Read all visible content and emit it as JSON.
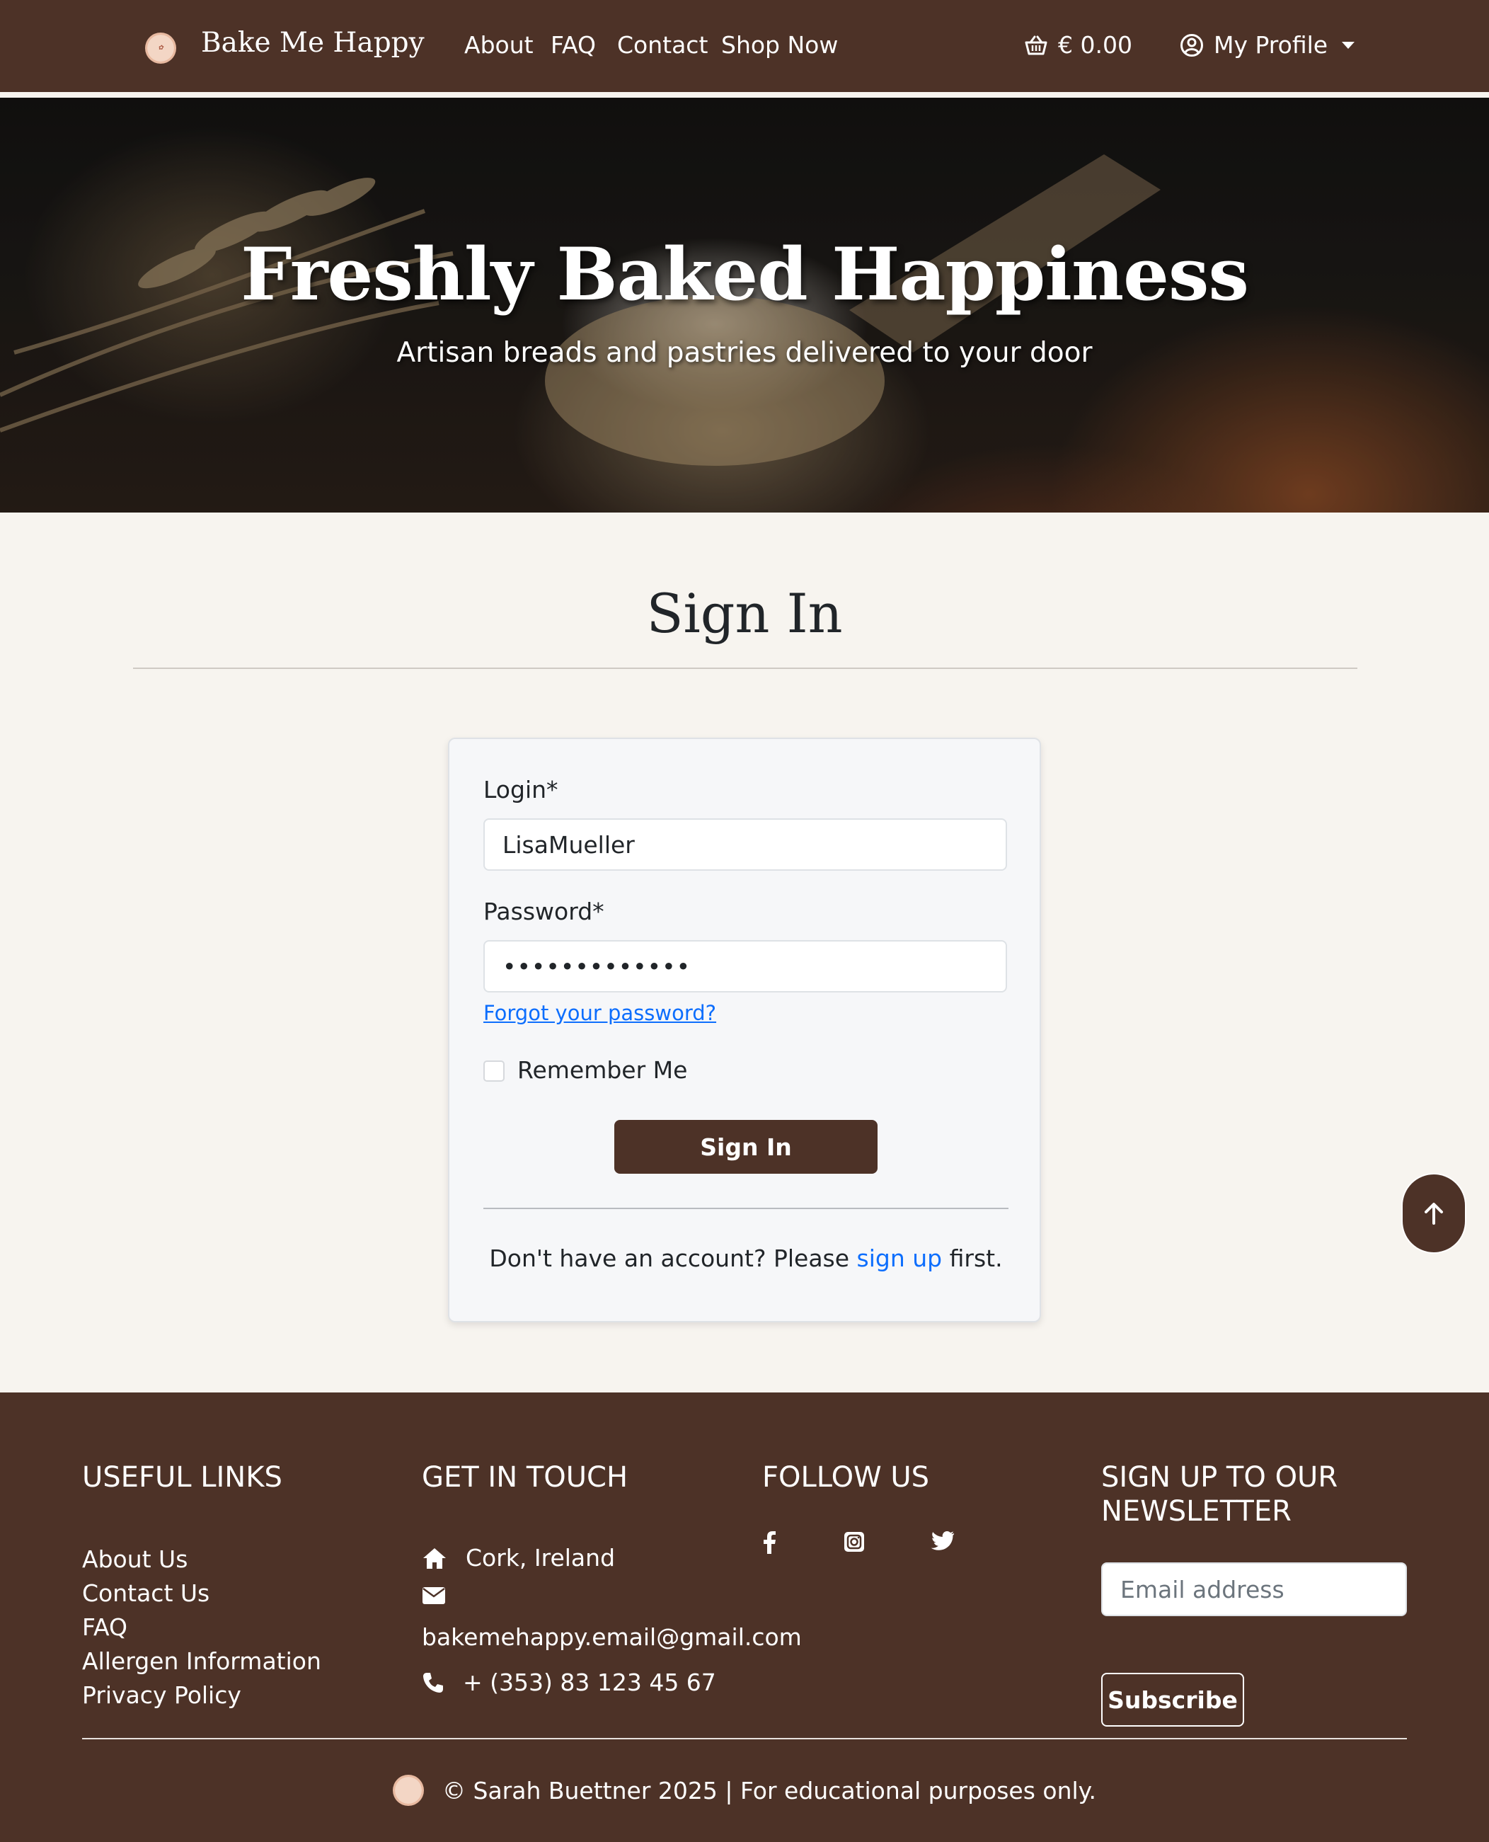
{
  "nav": {
    "brand": "Bake Me Happy",
    "links": [
      "About",
      "FAQ",
      "Contact",
      "Shop Now"
    ],
    "cart_total": "€ 0.00",
    "profile_label": "My Profile"
  },
  "hero": {
    "title": "Freshly Baked Happiness",
    "subtitle": "Artisan breads and pastries delivered to your door"
  },
  "signin": {
    "page_title": "Sign In",
    "login_label": "Login*",
    "login_value": "LisaMueller",
    "password_label": "Password*",
    "password_value": "•••••••••••••",
    "forgot_link": "Forgot your password?",
    "remember_label": "Remember Me",
    "button_label": "Sign In",
    "signup_prefix": "Don't have an account? Please",
    "signup_link": "sign up",
    "signup_suffix": "first."
  },
  "footer": {
    "useful_links_heading": "USEFUL LINKS",
    "useful_links": [
      "About Us",
      "Contact Us",
      "FAQ",
      "Allergen Information",
      "Privacy Policy"
    ],
    "get_in_touch_heading": "GET IN TOUCH",
    "location": "Cork, Ireland",
    "email": "bakemehappy.email@gmail.com",
    "phone": "+ (353) 83 123 45 67",
    "follow_heading": "FOLLOW US",
    "social_icons": [
      "facebook-icon",
      "instagram-icon",
      "twitter-icon"
    ],
    "newsletter_heading": "SIGN UP TO OUR NEWSLETTER",
    "newsletter_placeholder": "Email address",
    "subscribe_label": "Subscribe",
    "copyright": "© Sarah Buettner 2025 | For educational purposes only."
  },
  "colors": {
    "brand_brown": "#4d3227",
    "page_background": "#f7f4ef",
    "link_blue": "#0d6efd"
  }
}
